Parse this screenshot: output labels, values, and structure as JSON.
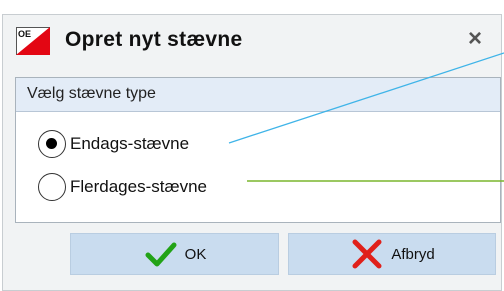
{
  "dialog": {
    "logo_text": "OE",
    "title": "Opret nyt stævne",
    "close_symbol": "×"
  },
  "group": {
    "header": "Vælg stævne type",
    "options": [
      {
        "label": "Endags-stævne",
        "selected": true
      },
      {
        "label": "Flerdages-stævne",
        "selected": false
      }
    ]
  },
  "buttons": {
    "ok_label": "OK",
    "cancel_label": "Afbryd"
  },
  "icons": {
    "logo": "orienteering-flag-icon",
    "close": "close-icon",
    "ok": "checkmark-icon",
    "cancel": "red-x-icon"
  },
  "colors": {
    "logo_red": "#e30613",
    "ok_green": "#22a317",
    "cancel_red": "#e0201a",
    "button_bg": "#c9dcef",
    "group_header_bg": "#e3ecf7",
    "callout_blue": "#3fb4e8",
    "callout_green": "#7ab52d"
  }
}
